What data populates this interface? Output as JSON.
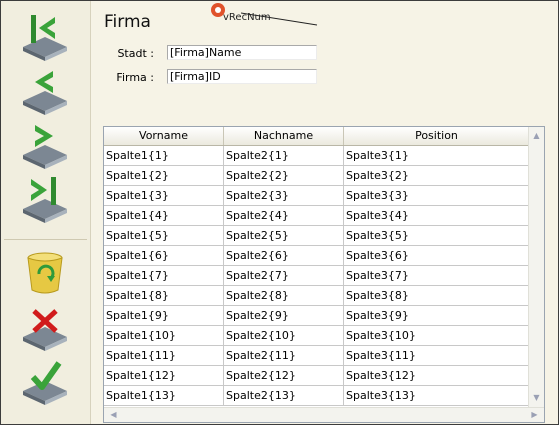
{
  "header": {
    "title": "Firma",
    "marker_label": "vRecNum"
  },
  "fields": [
    {
      "label": "Stadt :",
      "value": "[Firma]Name"
    },
    {
      "label": "Firma :",
      "value": "[Firma]ID"
    }
  ],
  "table": {
    "columns": [
      "Vorname",
      "Nachname",
      "Position"
    ],
    "rows": [
      [
        "Spalte1{1}",
        "Spalte2{1}",
        "Spalte3{1}"
      ],
      [
        "Spalte1{2}",
        "Spalte2{2}",
        "Spalte3{2}"
      ],
      [
        "Spalte1{3}",
        "Spalte2{3}",
        "Spalte3{3}"
      ],
      [
        "Spalte1{4}",
        "Spalte2{4}",
        "Spalte3{4}"
      ],
      [
        "Spalte1{5}",
        "Spalte2{5}",
        "Spalte3{5}"
      ],
      [
        "Spalte1{6}",
        "Spalte2{6}",
        "Spalte3{6}"
      ],
      [
        "Spalte1{7}",
        "Spalte2{7}",
        "Spalte3{7}"
      ],
      [
        "Spalte1{8}",
        "Spalte2{8}",
        "Spalte3{8}"
      ],
      [
        "Spalte1{9}",
        "Spalte2{9}",
        "Spalte3{9}"
      ],
      [
        "Spalte1{10}",
        "Spalte2{10}",
        "Spalte3{10}"
      ],
      [
        "Spalte1{11}",
        "Spalte2{11}",
        "Spalte3{11}"
      ],
      [
        "Spalte1{12}",
        "Spalte2{12}",
        "Spalte3{12}"
      ],
      [
        "Spalte1{13}",
        "Spalte2{13}",
        "Spalte3{13}"
      ]
    ]
  },
  "sidebar": {
    "buttons": [
      {
        "name": "first-record-button",
        "icon": "first-record-icon"
      },
      {
        "name": "previous-record-button",
        "icon": "previous-record-icon"
      },
      {
        "name": "next-record-button",
        "icon": "next-record-icon"
      },
      {
        "name": "last-record-button",
        "icon": "last-record-icon"
      },
      {
        "name": "delete-record-button",
        "icon": "recycle-bin-icon"
      },
      {
        "name": "cancel-button",
        "icon": "cancel-icon"
      },
      {
        "name": "accept-button",
        "icon": "accept-icon"
      }
    ]
  },
  "colors": {
    "icon_green": "#3aa33a",
    "icon_body": "#8d9aa6",
    "cancel_red": "#d11b1b",
    "bin_yellow": "#e6c843"
  }
}
